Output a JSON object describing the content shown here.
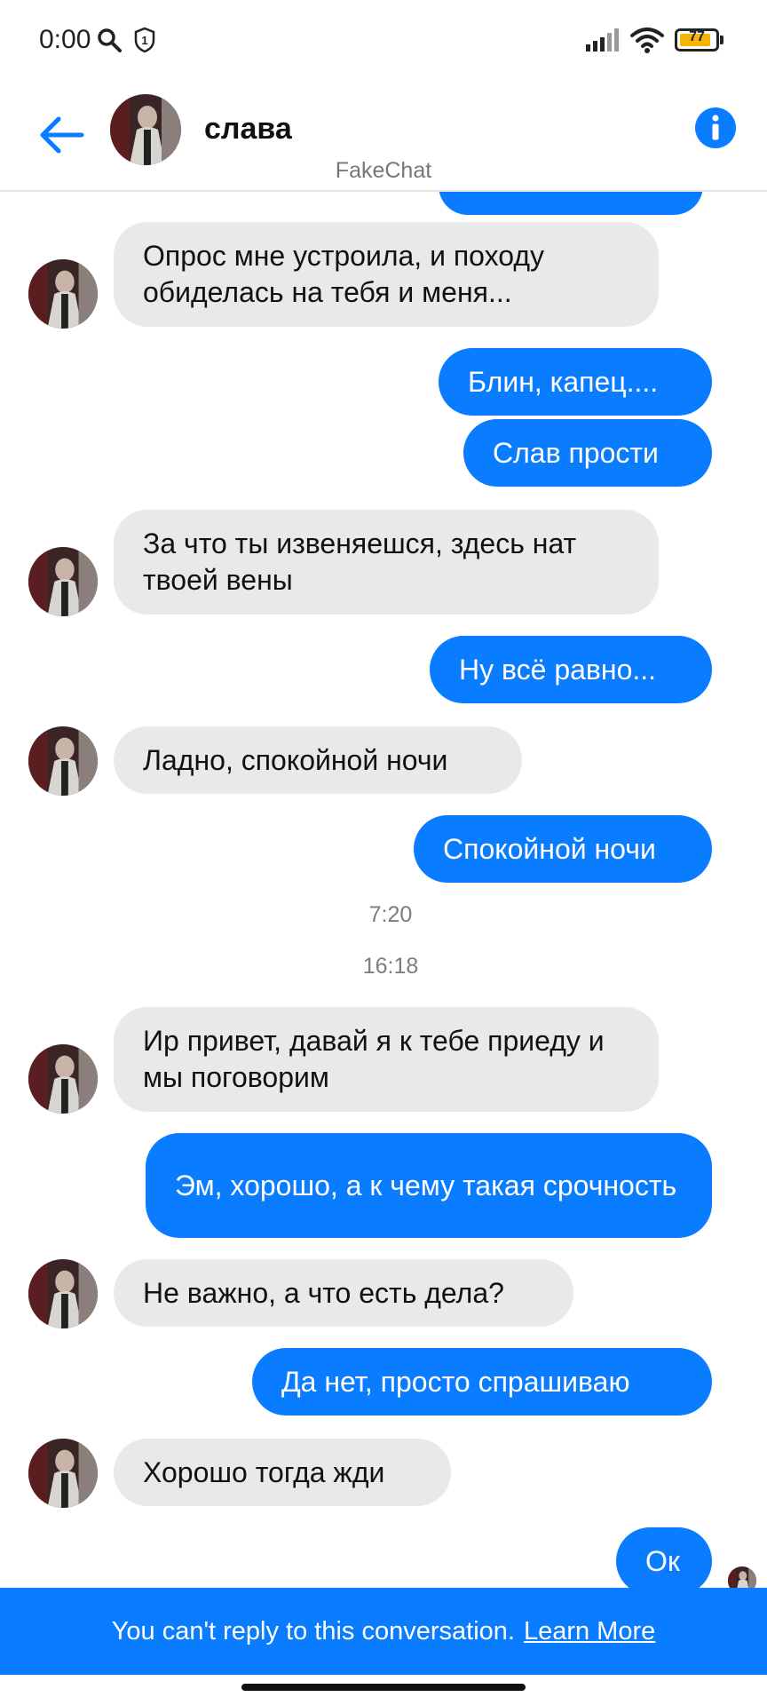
{
  "status_bar": {
    "time": "0:00",
    "battery": "77",
    "icons": [
      "search-icon",
      "shield-icon",
      "signal-icon",
      "wifi-icon",
      "battery-icon"
    ]
  },
  "header": {
    "back_icon": "back-arrow-icon",
    "contact_name": "слава",
    "subtitle": "FakeChat",
    "info_icon": "info-icon"
  },
  "colors": {
    "accent": "#0a7cff",
    "incoming_bubble": "#e9e9eb",
    "timestamp": "#7d7d7d"
  },
  "messages": [
    {
      "id": "m1",
      "dir": "in",
      "text": "Опрос мне устроила, и походу обиделась на тебя и меня..."
    },
    {
      "id": "m2",
      "dir": "out",
      "text": "Блин, капец...."
    },
    {
      "id": "m3",
      "dir": "out",
      "text": "Слав прости"
    },
    {
      "id": "m4",
      "dir": "in",
      "text": "За что ты извеняешся, здесь нат твоей вены"
    },
    {
      "id": "m5",
      "dir": "out",
      "text": "Ну всё равно..."
    },
    {
      "id": "m6",
      "dir": "in",
      "text": "Ладно, спокойной ночи"
    },
    {
      "id": "m7",
      "dir": "out",
      "text": "Спокойной ночи"
    },
    {
      "id": "m8",
      "dir": "in",
      "text": "Ир привет, давай я к тебе приеду и мы поговорим"
    },
    {
      "id": "m9",
      "dir": "out",
      "text": "Эм, хорошо, а к чему такая срочность"
    },
    {
      "id": "m10",
      "dir": "in",
      "text": "Не важно, а что есть дела?"
    },
    {
      "id": "m11",
      "dir": "out",
      "text": "Да нет, просто спрашиваю"
    },
    {
      "id": "m12",
      "dir": "in",
      "text": "Хорошо тогда жди"
    },
    {
      "id": "m13",
      "dir": "out",
      "text": "Ок"
    }
  ],
  "timestamps": [
    "7:20",
    "16:18"
  ],
  "footer": {
    "notice": "You can't reply to this conversation.",
    "learn_more": "Learn More"
  }
}
